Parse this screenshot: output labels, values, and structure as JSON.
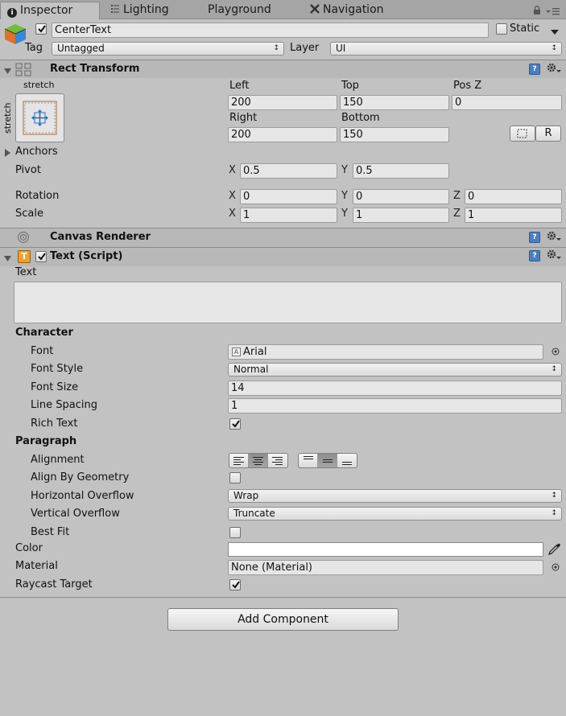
{
  "tabs": [
    {
      "label": "Inspector",
      "icon": "info-icon",
      "active": true
    },
    {
      "label": "Lighting",
      "icon": "lighting-icon",
      "active": false
    },
    {
      "label": "Playground",
      "icon": "",
      "active": false
    },
    {
      "label": "Navigation",
      "icon": "navigation-icon",
      "active": false
    }
  ],
  "object": {
    "name": "CenterText",
    "active": true,
    "static_label": "Static",
    "static_checked": false,
    "tag_label": "Tag",
    "tag_value": "Untagged",
    "layer_label": "Layer",
    "layer_value": "UI"
  },
  "rect_transform": {
    "title": "Rect Transform",
    "anchor_top_label": "stretch",
    "anchor_side_label": "stretch",
    "left_label": "Left",
    "left": "200",
    "top_label": "Top",
    "top": "150",
    "posz_label": "Pos Z",
    "posz": "0",
    "right_label": "Right",
    "right": "200",
    "bottom_label": "Bottom",
    "bottom": "150",
    "r_button": "R",
    "anchors_label": "Anchors",
    "pivot_label": "Pivot",
    "pivot_x": "0.5",
    "pivot_y": "0.5",
    "rotation_label": "Rotation",
    "rot_x": "0",
    "rot_y": "0",
    "rot_z": "0",
    "scale_label": "Scale",
    "scale_x": "1",
    "scale_y": "1",
    "scale_z": "1",
    "axis_x": "X",
    "axis_y": "Y",
    "axis_z": "Z"
  },
  "canvas_renderer": {
    "title": "Canvas Renderer"
  },
  "text_script": {
    "title": "Text (Script)",
    "enabled": true,
    "text_label": "Text",
    "text_value": "",
    "character_header": "Character",
    "font_label": "Font",
    "font_value": "Arial",
    "font_style_label": "Font Style",
    "font_style_value": "Normal",
    "font_size_label": "Font Size",
    "font_size_value": "14",
    "line_spacing_label": "Line Spacing",
    "line_spacing_value": "1",
    "rich_text_label": "Rich Text",
    "rich_text_checked": true,
    "paragraph_header": "Paragraph",
    "alignment_label": "Alignment",
    "align_by_geometry_label": "Align By Geometry",
    "align_by_geometry_checked": false,
    "h_overflow_label": "Horizontal Overflow",
    "h_overflow_value": "Wrap",
    "v_overflow_label": "Vertical Overflow",
    "v_overflow_value": "Truncate",
    "best_fit_label": "Best Fit",
    "best_fit_checked": false,
    "color_label": "Color",
    "color_value": "#ffffff",
    "material_label": "Material",
    "material_value": "None (Material)",
    "raycast_label": "Raycast Target",
    "raycast_checked": true
  },
  "add_component_label": "Add Component",
  "colors": {
    "panel_bg": "#c2c2c2",
    "field_bg": "#e6e6e6",
    "accent": "#4a7fbf"
  }
}
